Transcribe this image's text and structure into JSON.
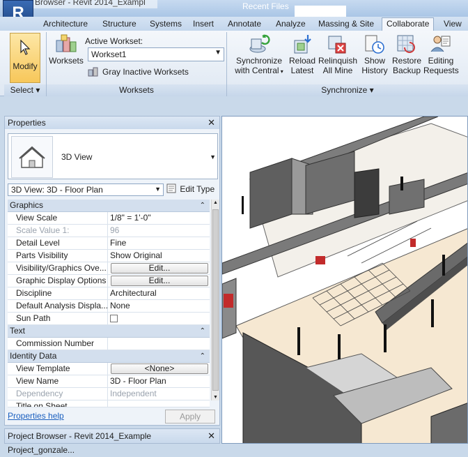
{
  "window": {
    "title": "Browser - Revit 2014_Exampl",
    "recent_files": "Recent Files"
  },
  "app_menu": {
    "letter": "R"
  },
  "tabs": [
    "Architecture",
    "Structure",
    "Systems",
    "Insert",
    "Annotate",
    "Analyze",
    "Massing & Site",
    "Collaborate",
    "View"
  ],
  "active_tab": "Collaborate",
  "ribbon": {
    "modify_label": "Modify",
    "worksets_label": "Worksets",
    "active_workset_label": "Active Workset:",
    "active_workset_value": "Workset1",
    "gray_inactive_label": "Gray Inactive Worksets",
    "sync_central_label": "Synchronize",
    "sync_central_label2": "with Central",
    "reload_latest_1": "Reload",
    "reload_latest_2": "Latest",
    "relinquish_1": "Relinquish",
    "relinquish_2": "All Mine",
    "show_history_1": "Show",
    "show_history_2": "History",
    "restore_backup_1": "Restore",
    "restore_backup_2": "Backup",
    "editing_requests_1": "Editing",
    "editing_requests_2": "Requests",
    "panels": {
      "select": "Select",
      "worksets": "Worksets",
      "synchronize": "Synchronize"
    }
  },
  "properties": {
    "title": "Properties",
    "type_name": "3D View",
    "instance_selector": "3D View: 3D - Floor Plan",
    "edit_type": "Edit Type",
    "groups": {
      "graphics": "Graphics",
      "text": "Text",
      "identity": "Identity Data"
    },
    "rows": {
      "view_scale": {
        "k": "View Scale",
        "v": "1/8\" = 1'-0\""
      },
      "scale_value": {
        "k": "Scale Value    1:",
        "v": "96"
      },
      "detail_level": {
        "k": "Detail Level",
        "v": "Fine"
      },
      "parts_visibility": {
        "k": "Parts Visibility",
        "v": "Show Original"
      },
      "vis_graphics": {
        "k": "Visibility/Graphics Ove...",
        "v": "Edit..."
      },
      "graphic_display": {
        "k": "Graphic Display Options",
        "v": "Edit..."
      },
      "discipline": {
        "k": "Discipline",
        "v": "Architectural"
      },
      "default_analysis": {
        "k": "Default Analysis Displa...",
        "v": "None"
      },
      "sun_path": {
        "k": "Sun Path",
        "v": ""
      },
      "commission": {
        "k": "Commission Number",
        "v": ""
      },
      "view_template": {
        "k": "View Template",
        "v": "<None>"
      },
      "view_name": {
        "k": "View Name",
        "v": "3D - Floor Plan"
      },
      "dependency": {
        "k": "Dependency",
        "v": "Independent"
      },
      "title_on_sheet": {
        "k": "Title on Sheet",
        "v": ""
      }
    },
    "help_link": "Properties help",
    "apply": "Apply"
  },
  "project_browser": {
    "title": "Project Browser - Revit 2014_Example Project_gonzale..."
  },
  "colors": {
    "accent": "#3a6cb5",
    "ribbon_bg": "#e8eef6",
    "floor": "#f6e8d2",
    "wall": "#6a6a6a",
    "door_red": "#c22b2b"
  }
}
